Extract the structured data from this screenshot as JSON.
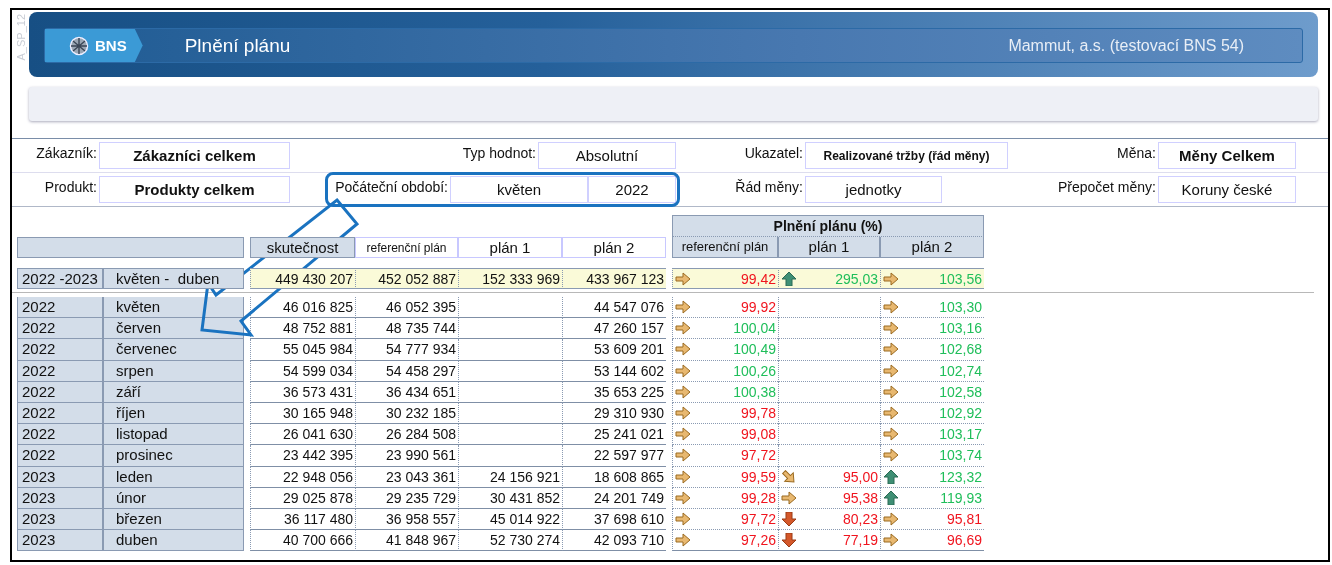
{
  "side_label": "A_SP_12",
  "header": {
    "logo": "BNS",
    "title": "Plnění plánu",
    "company": "Mammut, a.s. (testovací BNS 54)"
  },
  "filters": [
    [
      {
        "label": "Zákazník:",
        "values": [
          "Zákazníci celkem"
        ],
        "bold": true,
        "highlighted": false
      },
      {
        "label": "Typ hodnot:",
        "values": [
          "Absolutní"
        ],
        "bold": false,
        "highlighted": false
      },
      {
        "label": "Ukazatel:",
        "values": [
          "Realizované tržby (řád měny)"
        ],
        "bold": true,
        "highlighted": false
      },
      {
        "label": "Měna:",
        "values": [
          "Měny Celkem"
        ],
        "bold": true,
        "highlighted": false
      }
    ],
    [
      {
        "label": "Produkt:",
        "values": [
          "Produkty celkem"
        ],
        "bold": true,
        "highlighted": false
      },
      {
        "label": "Počáteční období:",
        "values": [
          "květen",
          "2022"
        ],
        "bold": false,
        "highlighted": true
      },
      {
        "label": "Řád měny:",
        "values": [
          "jednotky"
        ],
        "bold": false,
        "highlighted": false
      },
      {
        "label": "Přepočet měny:",
        "values": [
          "Koruny české"
        ],
        "bold": false,
        "highlighted": false
      }
    ]
  ],
  "table": {
    "group_header": "Plnění plánu (%)",
    "columns": [
      "skutečnost",
      "referenční plán",
      "plán 1",
      "plán 2"
    ],
    "percent_columns": [
      "referenční plán",
      "plán 1",
      "plán 2"
    ],
    "total": {
      "year": "2022 -2023",
      "month": "květen -  duben",
      "skutecnost": "449 430 207",
      "referencni_plan": "452 052 887",
      "plan_1": "152 333 969",
      "plan_2": "433 967 123",
      "pct_referencni_plan": {
        "value": "99,42",
        "kind": "right",
        "met": false
      },
      "pct_plan_1": {
        "value": "295,03",
        "kind": "up",
        "met": true
      },
      "pct_plan_2": {
        "value": "103,56",
        "kind": "right",
        "met": true
      }
    },
    "rows": [
      {
        "year": "2022",
        "month": "květen",
        "skutecnost": "46 016 825",
        "referencni_plan": "46 052 395",
        "plan_2": "44 547 076",
        "pct_referencni_plan": {
          "value": "99,92",
          "kind": "right",
          "met": false
        },
        "pct_plan_2": {
          "value": "103,30",
          "kind": "right",
          "met": true
        }
      },
      {
        "year": "2022",
        "month": "červen",
        "skutecnost": "48 752 881",
        "referencni_plan": "48 735 744",
        "plan_2": "47 260 157",
        "pct_referencni_plan": {
          "value": "100,04",
          "kind": "right",
          "met": true
        },
        "pct_plan_2": {
          "value": "103,16",
          "kind": "right",
          "met": true
        }
      },
      {
        "year": "2022",
        "month": "červenec",
        "skutecnost": "55 045 984",
        "referencni_plan": "54 777 934",
        "plan_2": "53 609 201",
        "pct_referencni_plan": {
          "value": "100,49",
          "kind": "right",
          "met": true
        },
        "pct_plan_2": {
          "value": "102,68",
          "kind": "right",
          "met": true
        }
      },
      {
        "year": "2022",
        "month": "srpen",
        "skutecnost": "54 599 034",
        "referencni_plan": "54 458 297",
        "plan_2": "53 144 602",
        "pct_referencni_plan": {
          "value": "100,26",
          "kind": "right",
          "met": true
        },
        "pct_plan_2": {
          "value": "102,74",
          "kind": "right",
          "met": true
        }
      },
      {
        "year": "2022",
        "month": "září",
        "skutecnost": "36 573 431",
        "referencni_plan": "36 434 651",
        "plan_2": "35 653 225",
        "pct_referencni_plan": {
          "value": "100,38",
          "kind": "right",
          "met": true
        },
        "pct_plan_2": {
          "value": "102,58",
          "kind": "right",
          "met": true
        }
      },
      {
        "year": "2022",
        "month": "říjen",
        "skutecnost": "30 165 948",
        "referencni_plan": "30 232 185",
        "plan_2": "29 310 930",
        "pct_referencni_plan": {
          "value": "99,78",
          "kind": "right",
          "met": false
        },
        "pct_plan_2": {
          "value": "102,92",
          "kind": "right",
          "met": true
        }
      },
      {
        "year": "2022",
        "month": "listopad",
        "skutecnost": "26 041 630",
        "referencni_plan": "26 284 508",
        "plan_2": "25 241 021",
        "pct_referencni_plan": {
          "value": "99,08",
          "kind": "right",
          "met": false
        },
        "pct_plan_2": {
          "value": "103,17",
          "kind": "right",
          "met": true
        }
      },
      {
        "year": "2022",
        "month": "prosinec",
        "skutecnost": "23 442 395",
        "referencni_plan": "23 990 561",
        "plan_2": "22 597 977",
        "pct_referencni_plan": {
          "value": "97,72",
          "kind": "right",
          "met": false
        },
        "pct_plan_2": {
          "value": "103,74",
          "kind": "right",
          "met": true
        }
      },
      {
        "year": "2023",
        "month": "leden",
        "skutecnost": "22 948 056",
        "referencni_plan": "23 043 361",
        "plan_1": "24 156 921",
        "plan_2": "18 608 865",
        "pct_referencni_plan": {
          "value": "99,59",
          "kind": "right",
          "met": false
        },
        "pct_plan_1": {
          "value": "95,00",
          "kind": "down-right",
          "met": false
        },
        "pct_plan_2": {
          "value": "123,32",
          "kind": "up",
          "met": true
        }
      },
      {
        "year": "2023",
        "month": "únor",
        "skutecnost": "29 025 878",
        "referencni_plan": "29 235 729",
        "plan_1": "30 431 852",
        "plan_2": "24 201 749",
        "pct_referencni_plan": {
          "value": "99,28",
          "kind": "right",
          "met": false
        },
        "pct_plan_1": {
          "value": "95,38",
          "kind": "right",
          "met": false
        },
        "pct_plan_2": {
          "value": "119,93",
          "kind": "up",
          "met": true
        }
      },
      {
        "year": "2023",
        "month": "březen",
        "skutecnost": "36 117 480",
        "referencni_plan": "36 958 557",
        "plan_1": "45 014 922",
        "plan_2": "37 698 610",
        "pct_referencni_plan": {
          "value": "97,72",
          "kind": "right",
          "met": false
        },
        "pct_plan_1": {
          "value": "80,23",
          "kind": "down",
          "met": false
        },
        "pct_plan_2": {
          "value": "95,81",
          "kind": "right",
          "met": false
        }
      },
      {
        "year": "2023",
        "month": "duben",
        "skutecnost": "40 700 666",
        "referencni_plan": "41 848 967",
        "plan_1": "52 730 274",
        "plan_2": "42 093 710",
        "pct_referencni_plan": {
          "value": "97,26",
          "kind": "right",
          "met": false
        },
        "pct_plan_1": {
          "value": "77,19",
          "kind": "down",
          "met": false
        },
        "pct_plan_2": {
          "value": "96,69",
          "kind": "right",
          "met": false
        }
      }
    ]
  }
}
